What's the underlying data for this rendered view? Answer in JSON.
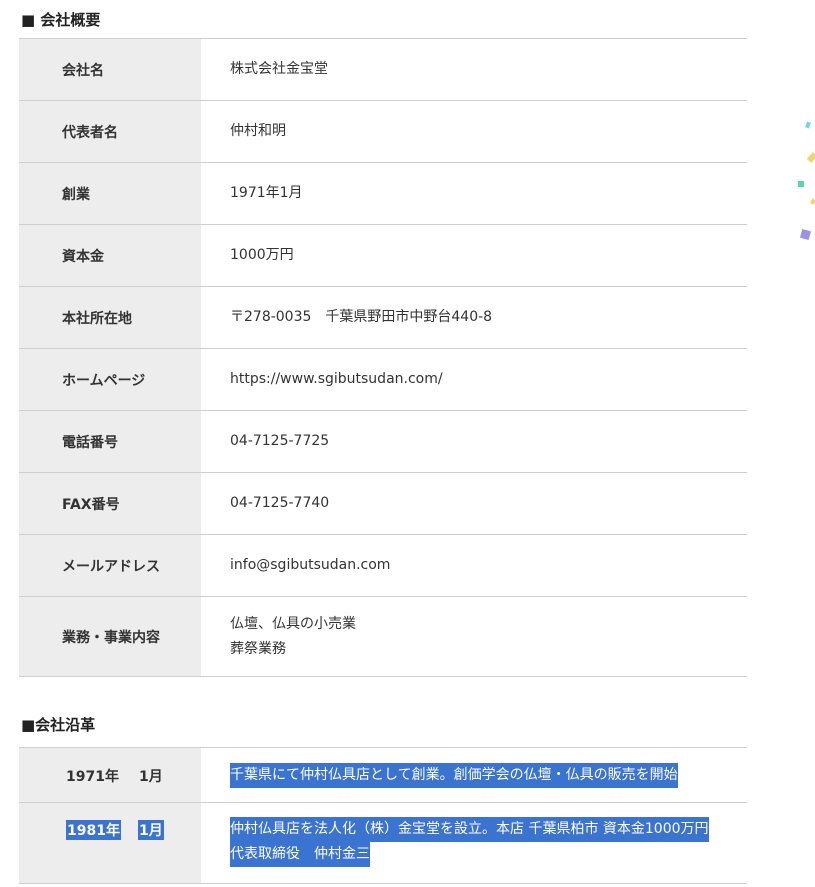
{
  "overview": {
    "title": "■ 会社概要",
    "rows": [
      {
        "label": "会社名",
        "value": "株式会社金宝堂"
      },
      {
        "label": "代表者名",
        "value": "仲村和明"
      },
      {
        "label": "創業",
        "value": "1971年1月"
      },
      {
        "label": "資本金",
        "value": "1000万円"
      },
      {
        "label": "本社所在地",
        "value": "〒278-0035　千葉県野田市中野台440-8"
      },
      {
        "label": "ホームページ",
        "value": "https://www.sgibutsudan.com/"
      },
      {
        "label": "電話番号",
        "value": "04-7125-7725"
      },
      {
        "label": "FAX番号",
        "value": "04-7125-7740"
      },
      {
        "label": "メールアドレス",
        "value": "info@sgibutsudan.com"
      },
      {
        "label": "業務・事業内容",
        "value": "仏壇、仏具の小売業",
        "value2": "葬祭業務"
      }
    ]
  },
  "history": {
    "title": "■会社沿革",
    "rows": [
      {
        "year": "1971年",
        "month": "1月",
        "text": "千葉県にて仲村仏具店として創業。創価学会の仏壇・仏具の販売を開始"
      },
      {
        "year": "1981年",
        "month": "1月",
        "text": "仲村仏具店を法人化（株）金宝堂を設立。本店 千葉県柏市 資本金1000万円",
        "text2": "代表取締役　仲村金三"
      }
    ]
  },
  "colors": {
    "header_bg": "#ededed",
    "selection": "#3b73d1",
    "border": "#cfcfcf"
  }
}
